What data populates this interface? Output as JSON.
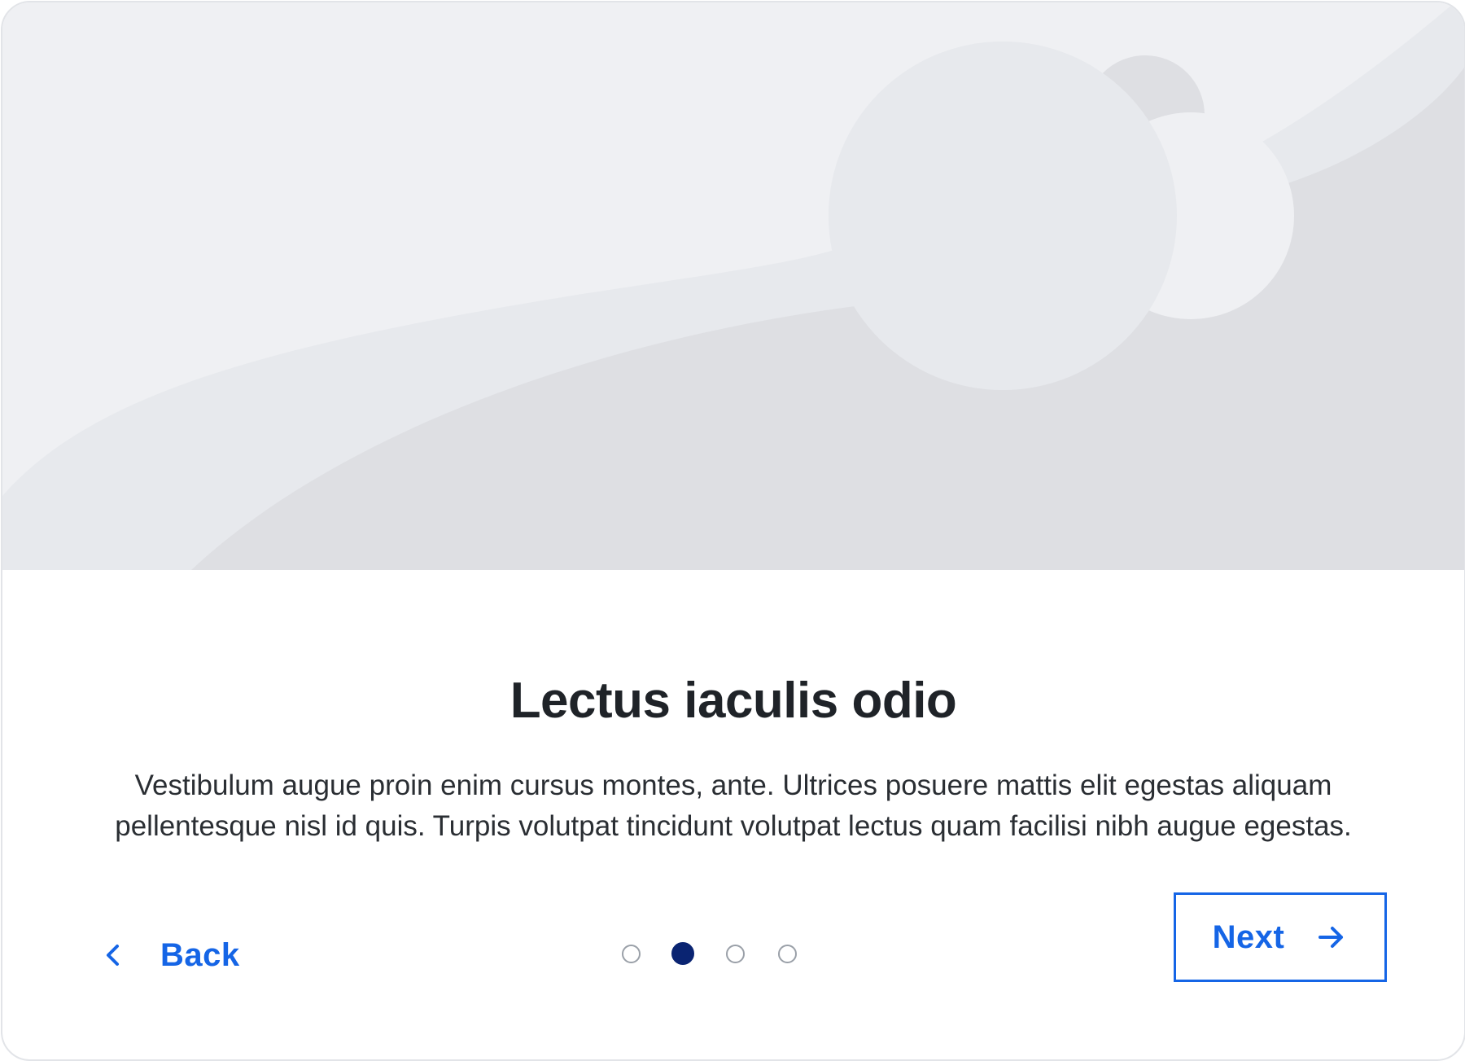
{
  "carousel": {
    "title": "Lectus iaculis odio",
    "description": "Vestibulum augue proin enim cursus montes, ante. Ultrices posuere mattis elit egestas aliquam pellentesque nisl id quis. Turpis volutpat tincidunt volutpat lectus quam facilisi nibh augue egestas.",
    "back_label": "Back",
    "next_label": "Next",
    "pagination": {
      "total": 4,
      "current": 2
    }
  },
  "icons": {
    "back": "chevron-left-icon",
    "next": "arrow-right-icon"
  },
  "colors": {
    "accent": "#1565e6",
    "active_dot": "#0a2472",
    "inactive_dot_border": "#9aa0a8",
    "title_text": "#1f2328",
    "body_text": "#2a2e33",
    "illustration_light": "#eff0f3",
    "illustration_mid": "#e7e9ed",
    "illustration_dark": "#dedfe3"
  }
}
